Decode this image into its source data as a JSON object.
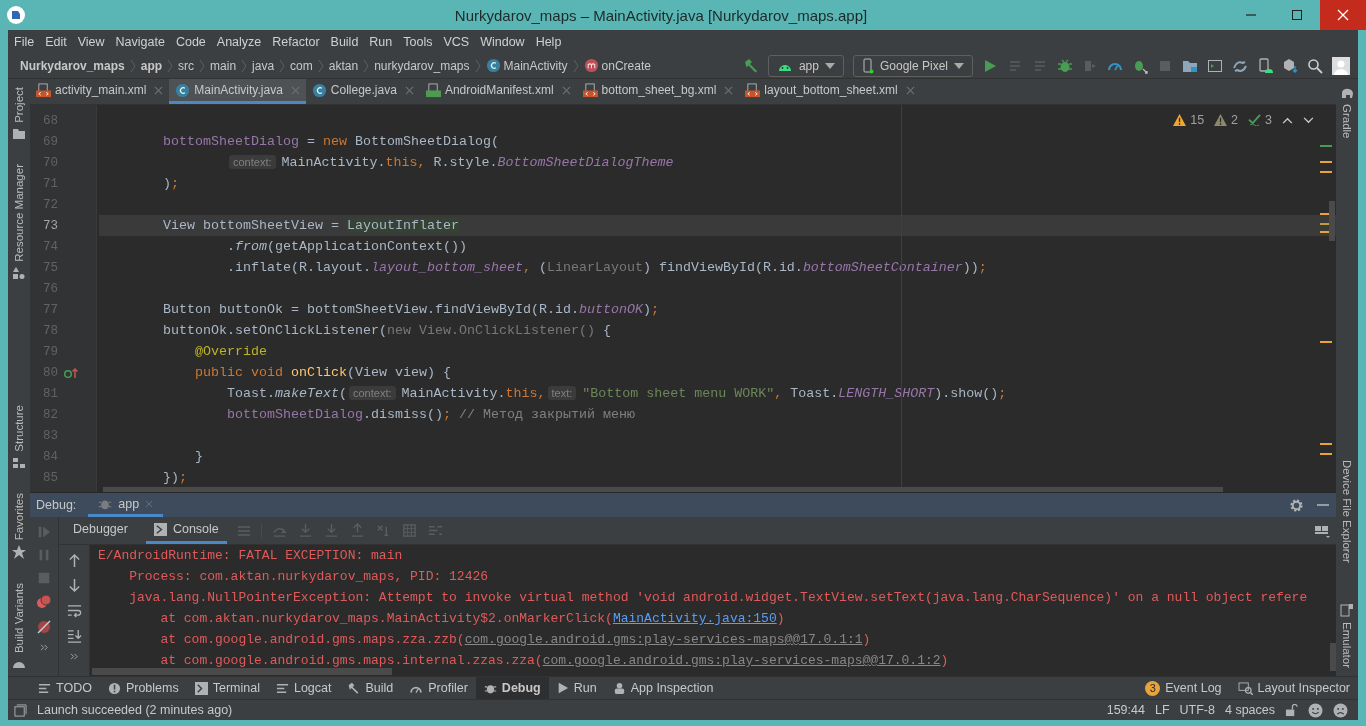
{
  "window": {
    "title": "Nurkydarov_maps – MainActivity.java [Nurkydarov_maps.app]"
  },
  "menu": [
    "File",
    "Edit",
    "View",
    "Navigate",
    "Code",
    "Analyze",
    "Refactor",
    "Build",
    "Run",
    "Tools",
    "VCS",
    "Window",
    "Help"
  ],
  "breadcrumb": [
    {
      "label": "Nurkydarov_maps",
      "kind": "module"
    },
    {
      "label": "app",
      "kind": "module"
    },
    {
      "label": "src",
      "kind": "folder"
    },
    {
      "label": "main",
      "kind": "folder"
    },
    {
      "label": "java",
      "kind": "folder"
    },
    {
      "label": "com",
      "kind": "folder"
    },
    {
      "label": "aktan",
      "kind": "folder"
    },
    {
      "label": "nurkydarov_maps",
      "kind": "folder"
    },
    {
      "label": "MainActivity",
      "kind": "class"
    },
    {
      "label": "onCreate",
      "kind": "method"
    }
  ],
  "run_config": {
    "label": "app"
  },
  "device": {
    "label": "Google Pixel"
  },
  "tabs": [
    {
      "label": "activity_main.xml",
      "kind": "layout",
      "selected": false
    },
    {
      "label": "MainActivity.java",
      "kind": "class",
      "selected": true
    },
    {
      "label": "College.java",
      "kind": "class",
      "selected": false
    },
    {
      "label": "AndroidManifest.xml",
      "kind": "manifest",
      "selected": false
    },
    {
      "label": "bottom_sheet_bg.xml",
      "kind": "layout",
      "selected": false
    },
    {
      "label": "layout_bottom_sheet.xml",
      "kind": "layout",
      "selected": false
    }
  ],
  "inspections": {
    "warnings": "15",
    "weak_warnings": "2",
    "typos": "3"
  },
  "left_tools": [
    {
      "label": "Project",
      "kind": "folder"
    },
    {
      "label": "Resource Manager",
      "kind": "resources"
    },
    {
      "label": "Structure",
      "kind": "structure"
    },
    {
      "label": "Favorites",
      "kind": "star"
    },
    {
      "label": "Build Variants",
      "kind": "android"
    }
  ],
  "right_tools": [
    {
      "label": "Gradle",
      "kind": "elephant"
    },
    {
      "label": "Device File Explorer",
      "kind": "none"
    },
    {
      "label": "Emulator",
      "kind": "phone"
    }
  ],
  "code": [
    {
      "number": "68",
      "kind": "plain",
      "current": false
    },
    {
      "number": "69",
      "kind": "plain",
      "current": false,
      "tokens": [
        {
          "kind": "field",
          "text": "        bottomSheetDialog"
        },
        {
          "kind": "plain",
          "text": " = "
        },
        {
          "kind": "kw",
          "text": "new"
        },
        {
          "kind": "plain",
          "text": " BottomSheetDialog("
        }
      ]
    },
    {
      "number": "70",
      "kind": "plain",
      "current": false,
      "tokens": [
        {
          "kind": "hint",
          "text": "                context:"
        },
        {
          "kind": "plain",
          "text": "MainActivity."
        },
        {
          "kind": "kw",
          "text": "this,"
        },
        {
          "kind": "plain",
          "text": " R.style."
        },
        {
          "kind": "sfield",
          "text": "BottomSheetDialogTheme"
        }
      ]
    },
    {
      "number": "71",
      "kind": "plain",
      "current": false,
      "tokens": [
        {
          "kind": "plain",
          "text": "        )"
        },
        {
          "kind": "kw",
          "text": ";"
        }
      ]
    },
    {
      "number": "72",
      "kind": "plain",
      "current": false
    },
    {
      "number": "73",
      "kind": "plain",
      "current": true,
      "tokens": [
        {
          "kind": "plain",
          "text": "        View bottomSheetView = "
        },
        {
          "kind": "hl",
          "text": "LayoutInflater"
        }
      ]
    },
    {
      "number": "74",
      "kind": "plain",
      "current": false,
      "tokens": [
        {
          "kind": "plain",
          "text": "                ."
        },
        {
          "kind": "it",
          "text": "from"
        },
        {
          "kind": "plain",
          "text": "(getApplicationContext())"
        }
      ]
    },
    {
      "number": "75",
      "kind": "plain",
      "current": false,
      "tokens": [
        {
          "kind": "plain",
          "text": "                .inflate(R.layout."
        },
        {
          "kind": "sfield",
          "text": "layout_bottom_sheet"
        },
        {
          "kind": "kw",
          "text": ","
        },
        {
          "kind": "plain",
          "text": " ("
        },
        {
          "kind": "dim",
          "text": "LinearLayout"
        },
        {
          "kind": "plain",
          "text": ") findViewById(R.id."
        },
        {
          "kind": "sfield",
          "text": "bottomSheetContainer"
        },
        {
          "kind": "plain",
          "text": "))"
        },
        {
          "kind": "kw",
          "text": ";"
        }
      ]
    },
    {
      "number": "76",
      "kind": "plain",
      "current": false
    },
    {
      "number": "77",
      "kind": "plain",
      "current": false,
      "tokens": [
        {
          "kind": "plain",
          "text": "        Button buttonOk = bottomSheetView.findViewById(R.id."
        },
        {
          "kind": "sfield",
          "text": "buttonOK"
        },
        {
          "kind": "plain",
          "text": ")"
        },
        {
          "kind": "kw",
          "text": ";"
        }
      ]
    },
    {
      "number": "78",
      "kind": "plain",
      "current": false,
      "tokens": [
        {
          "kind": "plain",
          "text": "        buttonOk.setOnClickListener("
        },
        {
          "kind": "dim",
          "text": "new View.OnClickListener()"
        },
        {
          "kind": "plain",
          "text": " {"
        }
      ]
    },
    {
      "number": "79",
      "kind": "plain",
      "current": false,
      "tokens": [
        {
          "kind": "annot",
          "text": "            @Override"
        }
      ]
    },
    {
      "number": "80",
      "kind": "override",
      "current": false,
      "tokens": [
        {
          "kind": "kw",
          "text": "            public void "
        },
        {
          "kind": "fn",
          "text": "onClick"
        },
        {
          "kind": "plain",
          "text": "(View view) {"
        }
      ]
    },
    {
      "number": "81",
      "kind": "plain",
      "current": false,
      "tokens": [
        {
          "kind": "plain",
          "text": "                Toast."
        },
        {
          "kind": "it",
          "text": "makeText"
        },
        {
          "kind": "plain",
          "text": "("
        },
        {
          "kind": "hint",
          "text": "context:"
        },
        {
          "kind": "plain",
          "text": "MainActivity."
        },
        {
          "kind": "kw",
          "text": "this,"
        },
        {
          "kind": "hint",
          "text": "text:"
        },
        {
          "kind": "str",
          "text": "\"Bottom sheet menu WORK\""
        },
        {
          "kind": "kw",
          "text": ","
        },
        {
          "kind": "plain",
          "text": " Toast."
        },
        {
          "kind": "sfield",
          "text": "LENGTH_SHORT"
        },
        {
          "kind": "plain",
          "text": ").show()"
        },
        {
          "kind": "kw",
          "text": ";"
        }
      ]
    },
    {
      "number": "82",
      "kind": "plain",
      "current": false,
      "tokens": [
        {
          "kind": "field",
          "text": "                bottomSheetDialog"
        },
        {
          "kind": "plain",
          "text": ".dismiss()"
        },
        {
          "kind": "kw",
          "text": ";"
        },
        {
          "kind": "cmt",
          "text": " // Метод закрытий меню"
        }
      ]
    },
    {
      "number": "83",
      "kind": "plain",
      "current": false
    },
    {
      "number": "84",
      "kind": "plain",
      "current": false,
      "tokens": [
        {
          "kind": "plain",
          "text": "            }"
        }
      ]
    },
    {
      "number": "85",
      "kind": "plain",
      "current": false,
      "tokens": [
        {
          "kind": "plain",
          "text": "        })"
        },
        {
          "kind": "kw",
          "text": ";"
        }
      ]
    }
  ],
  "debug": {
    "title": "Debug:",
    "session": "app",
    "tabs": [
      {
        "label": "Debugger",
        "selected": false
      },
      {
        "label": "Console",
        "selected": true
      }
    ],
    "console": [
      {
        "parts": [
          {
            "kind": "text",
            "text": "E/AndroidRuntime: FATAL EXCEPTION: main"
          }
        ]
      },
      {
        "parts": [
          {
            "kind": "text",
            "text": "    Process: com.aktan.nurkydarov_maps, PID: 12426"
          }
        ]
      },
      {
        "parts": [
          {
            "kind": "text",
            "text": "    java.lang.NullPointerException: Attempt to invoke virtual method 'void android.widget.TextView.setText(java.lang.CharSequence)' on a null object refere"
          }
        ]
      },
      {
        "parts": [
          {
            "kind": "text",
            "text": "        at com.aktan.nurkydarov_maps.MainActivity$2.onMarkerClick("
          },
          {
            "kind": "link",
            "text": "MainActivity.java:150"
          },
          {
            "kind": "text",
            "text": ")"
          }
        ]
      },
      {
        "parts": [
          {
            "kind": "text",
            "text": "        at com.google.android.gms.maps.zza.zzb("
          },
          {
            "kind": "lib",
            "text": "com.google.android.gms:play-services-maps@@17.0.1:1"
          },
          {
            "kind": "text",
            "text": ")"
          }
        ]
      },
      {
        "parts": [
          {
            "kind": "text",
            "text": "        at com.google.android.gms.maps.internal.zzas.zza("
          },
          {
            "kind": "lib",
            "text": "com.google.android.gms:play-services-maps@@17.0.1:2"
          },
          {
            "kind": "text",
            "text": ")"
          }
        ]
      }
    ]
  },
  "tool_windows": [
    {
      "label": "TODO",
      "kind": "list",
      "selected": false
    },
    {
      "label": "Problems",
      "kind": "alert",
      "selected": false
    },
    {
      "label": "Terminal",
      "kind": "terminal",
      "selected": false
    },
    {
      "label": "Logcat",
      "kind": "list",
      "selected": false
    },
    {
      "label": "Build",
      "kind": "hammer",
      "selected": false
    },
    {
      "label": "Profiler",
      "kind": "gauge",
      "selected": false
    },
    {
      "label": "Debug",
      "kind": "bug",
      "selected": true
    },
    {
      "label": "Run",
      "kind": "play",
      "selected": false
    },
    {
      "label": "App Inspection",
      "kind": "inspect",
      "selected": false
    }
  ],
  "event_log": {
    "count": "3",
    "label": "Event Log"
  },
  "layout_inspector": {
    "label": "Layout Inspector"
  },
  "status": {
    "message": "Launch succeeded (2 minutes ago)",
    "position": "159:44",
    "line_separator": "LF",
    "encoding": "UTF-8",
    "indent": "4 spaces"
  }
}
